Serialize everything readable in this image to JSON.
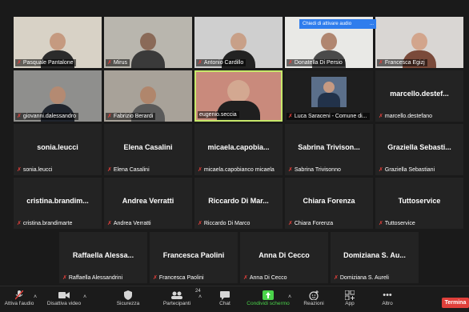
{
  "tooltip": {
    "text": "Chiedi di attivare audio",
    "more": "..."
  },
  "participants": [
    {
      "id": "p1",
      "label": "Pasquale Pantalone",
      "video": true
    },
    {
      "id": "p2",
      "label": "Mirus",
      "video": true
    },
    {
      "id": "p3",
      "label": "Antonio Cardillo",
      "video": true
    },
    {
      "id": "p4",
      "label": "Donatella Di Persio",
      "video": true
    },
    {
      "id": "p5",
      "label": "Francesca Egizj",
      "video": true
    },
    {
      "id": "p6",
      "label": "giovanni.dalessandro",
      "video": true
    },
    {
      "id": "p7",
      "label": "Fabrizio Berardi",
      "video": true
    },
    {
      "id": "p8",
      "label": "eugenio.seccia",
      "video": true,
      "active": true
    },
    {
      "id": "p9",
      "label": "Luca Saraceni - Comune di...",
      "video": true
    },
    {
      "id": "p10",
      "center": "marcello.destef...",
      "label": "marcello.destefano"
    },
    {
      "id": "p11",
      "center": "sonia.leucci",
      "label": "sonia.leucci"
    },
    {
      "id": "p12",
      "center": "Elena Casalini",
      "label": "Elena Casalini"
    },
    {
      "id": "p13",
      "center": "micaela.capobia...",
      "label": "micaela.capobianco micaela"
    },
    {
      "id": "p14",
      "center": "Sabrina Trivison...",
      "label": "Sabrina Trivisonno"
    },
    {
      "id": "p15",
      "center": "Graziella Sebasti...",
      "label": "Graziella Sebastiani"
    },
    {
      "id": "p16",
      "center": "cristina.brandim...",
      "label": "cristina.brandimarte"
    },
    {
      "id": "p17",
      "center": "Andrea Verratti",
      "label": "Andrea Verratti"
    },
    {
      "id": "p18",
      "center": "Riccardo Di Mar...",
      "label": "Riccardo Di Marco"
    },
    {
      "id": "p19",
      "center": "Chiara Forenza",
      "label": "Chiara Forenza"
    },
    {
      "id": "p20",
      "center": "Tuttoservice",
      "label": "Tuttoservice"
    },
    {
      "id": "p21",
      "center": "Raffaella Alessa...",
      "label": "Raffaella Alessandrini"
    },
    {
      "id": "p22",
      "center": "Francesca Paolini",
      "label": "Francesca Paolini"
    },
    {
      "id": "p23",
      "center": "Anna Di Cecco",
      "label": "Anna Di Cecco"
    },
    {
      "id": "p24",
      "center": "Domiziana S. Au...",
      "label": "Domiziana S. Aureli"
    }
  ],
  "toolbar": {
    "audio": "Attiva l'audio",
    "video": "Disattiva video",
    "security": "Sicurezza",
    "participants": "Partecipanti",
    "participants_count": "24",
    "chat": "Chat",
    "share": "Condividi schermo",
    "reactions": "Reazioni",
    "apps": "App",
    "more": "Altro",
    "end": "Termina"
  }
}
